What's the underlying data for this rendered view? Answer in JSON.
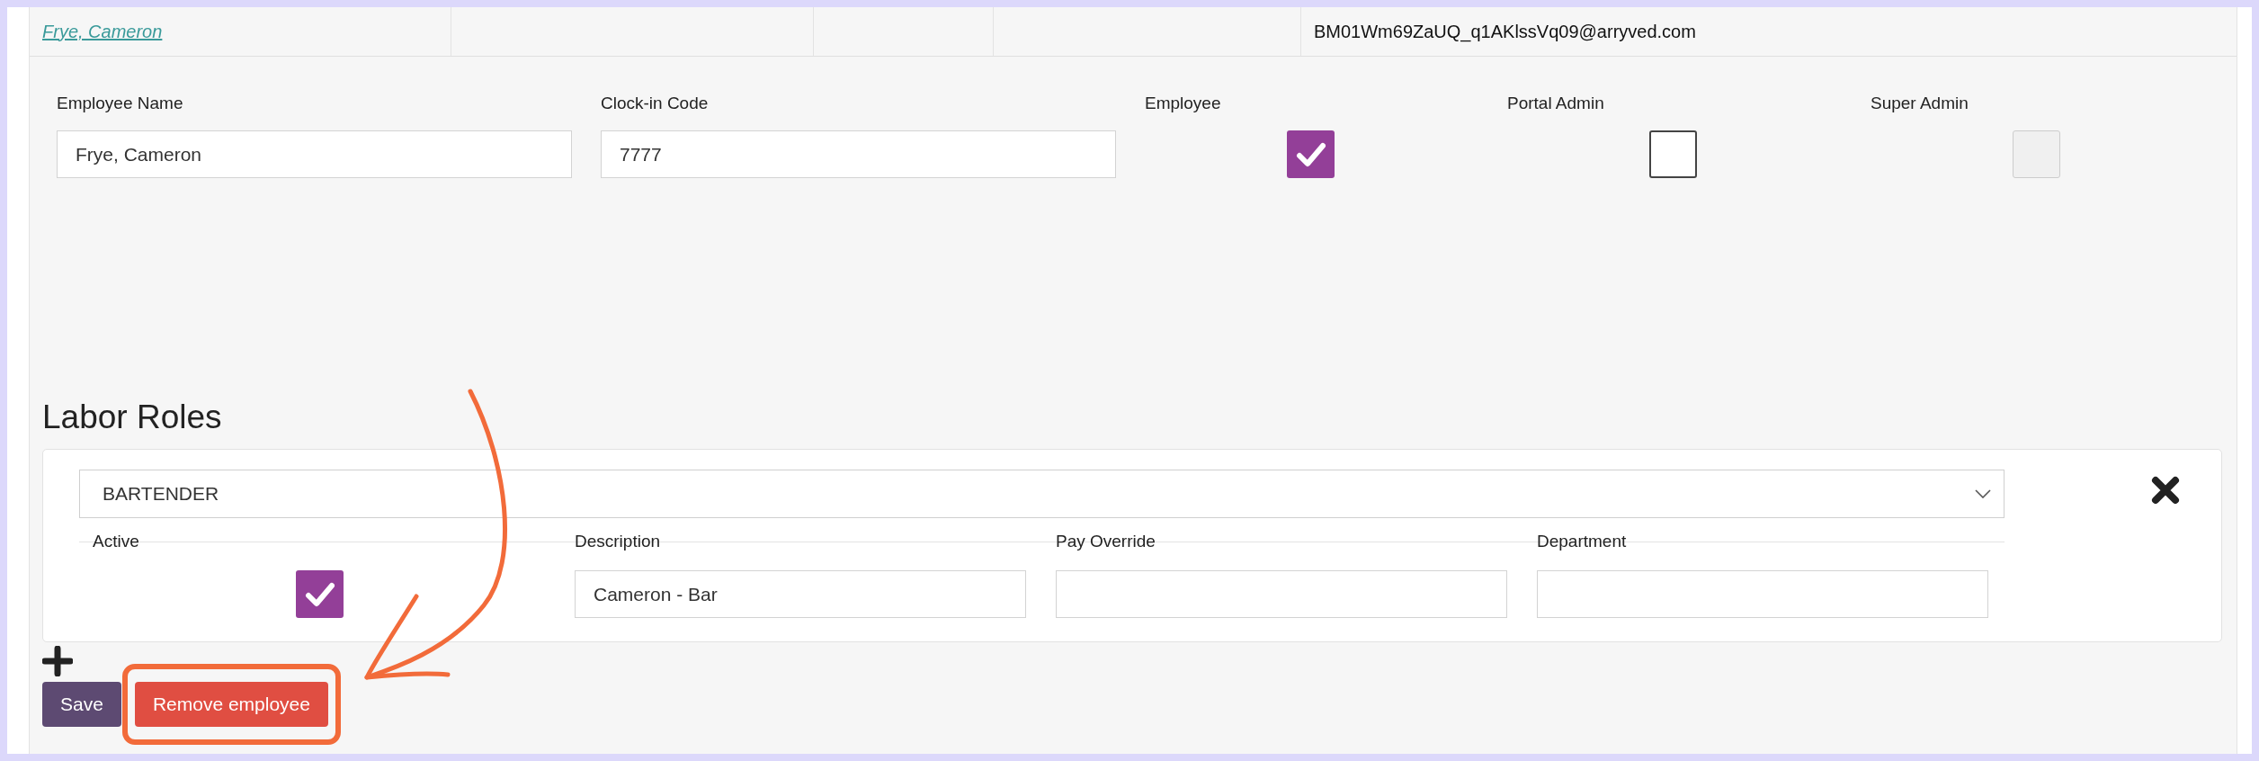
{
  "table_row": {
    "name_link": "Frye, Cameron",
    "email": "BM01Wm69ZaUQ_q1AKlssVq09@arryved.com"
  },
  "employee_form": {
    "fields": [
      {
        "label": "Employee Name",
        "value": "Frye, Cameron"
      },
      {
        "label": "Clock-in Code",
        "value": "7777"
      }
    ],
    "permissions": [
      {
        "label": "Employee",
        "checked": true,
        "disabled": false
      },
      {
        "label": "Portal Admin",
        "checked": false,
        "disabled": false
      },
      {
        "label": "Super Admin",
        "checked": false,
        "disabled": true
      }
    ]
  },
  "labor_roles": {
    "title": "Labor Roles",
    "columns": [
      "Active",
      "Description",
      "Pay Override",
      "Department"
    ],
    "roles": [
      {
        "role": "BARTENDER",
        "active": true,
        "description": "Cameron - Bar"
      }
    ]
  },
  "buttons": [
    {
      "kind": "primary",
      "label": "Save",
      "highlighted": false
    },
    {
      "kind": "danger",
      "label": "Remove employee",
      "highlighted": true
    }
  ]
}
